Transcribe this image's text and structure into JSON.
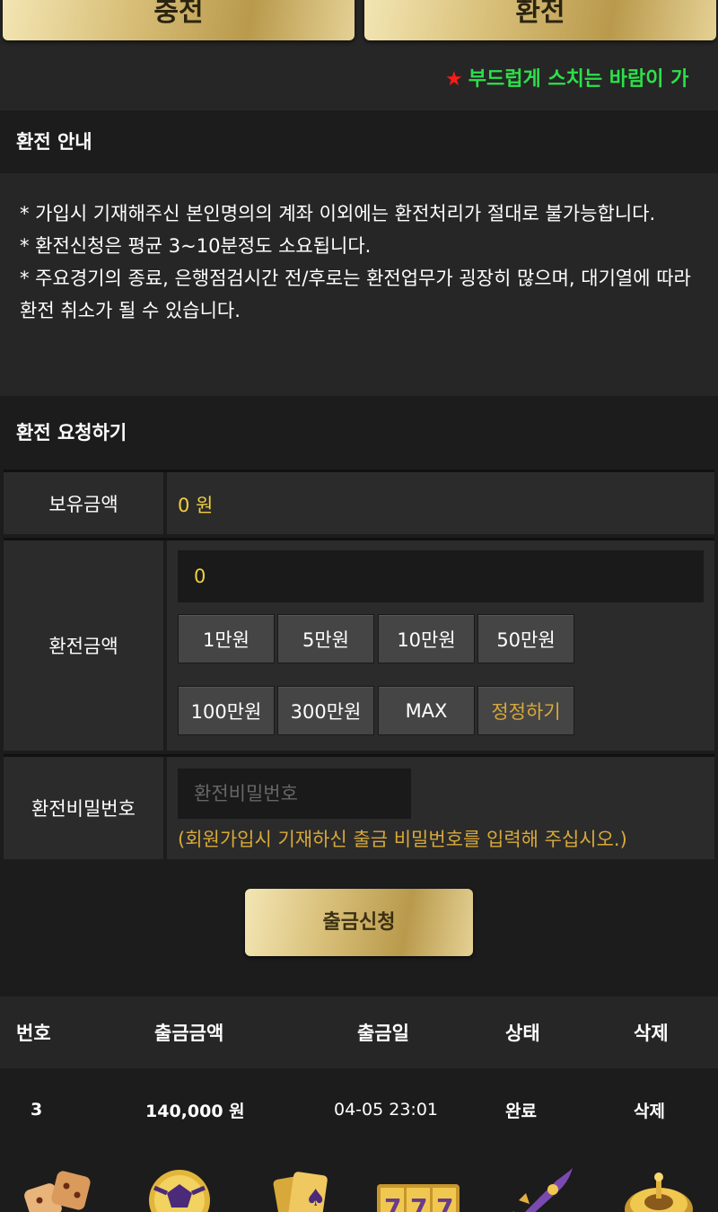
{
  "top_tabs": {
    "deposit": "충전",
    "withdraw": "환전"
  },
  "marquee": {
    "star": "★",
    "text": "부드럽게 스치는 바람이 가"
  },
  "notice": {
    "title": "환전 안내",
    "lines": [
      "* 가입시 기재해주신 본인명의의 계좌 이외에는 환전처리가 절대로 불가능합니다.",
      "* 환전신청은 평균 3~10분정도 소요됩니다.",
      "* 주요경기의 종료, 은행점검시간 전/후로는 환전업무가 굉장히 많으며, 대기열에 따라 환전 취소가 될 수 있습니다."
    ]
  },
  "request": {
    "title": "환전 요청하기",
    "balance_label": "보유금액",
    "balance_value": "0 원",
    "amount_label": "환전금액",
    "amount_value": "0",
    "amount_buttons": [
      "1만원",
      "5만원",
      "10만원",
      "50만원",
      "100만원",
      "300만원",
      "MAX",
      "정정하기"
    ],
    "password_label": "환전비밀번호",
    "password_placeholder": "환전비밀번호",
    "password_hint": "(회원가입시 기재하신 출금 비밀번호를 입력해 주십시오.)",
    "submit": "출금신청"
  },
  "history": {
    "headers": {
      "no": "번호",
      "amount": "출금금액",
      "date": "출금일",
      "status": "상태",
      "delete": "삭제"
    },
    "rows": [
      {
        "no": "3",
        "amount": "140,000 원",
        "date": "04-05 23:01",
        "status": "완료",
        "delete": "삭제"
      }
    ]
  },
  "colors": {
    "accent_gold": "#d8a93a",
    "value_yellow": "#f0d040",
    "marquee_green": "#2de04a",
    "star_red": "#ff1a1a"
  },
  "game_icons": [
    "dice-icon",
    "soccer-ball-icon",
    "playing-cards-icon",
    "slot-777-icon",
    "rocket-icon",
    "roulette-icon"
  ]
}
